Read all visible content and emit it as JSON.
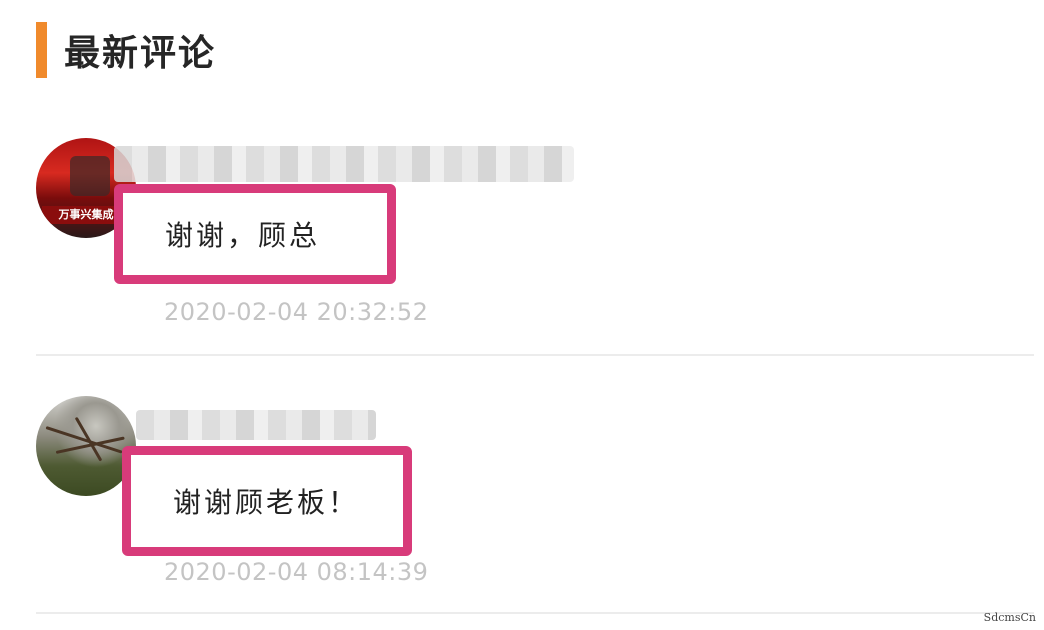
{
  "section": {
    "title": "最新评论",
    "accent_color": "#f08a2c"
  },
  "comments": [
    {
      "avatar_icon": "avatar-icon",
      "avatar_caption": "万事兴集成",
      "username_blurred": true,
      "content": "谢谢，顾总",
      "timestamp": "2020-02-04 20:32:52"
    },
    {
      "avatar_icon": "avatar-icon",
      "username_blurred": true,
      "content": "谢谢顾老板！",
      "timestamp": "2020-02-04 08:14:39"
    }
  ],
  "highlight_color": "#d83b7a",
  "watermark": "SdcmsCn"
}
